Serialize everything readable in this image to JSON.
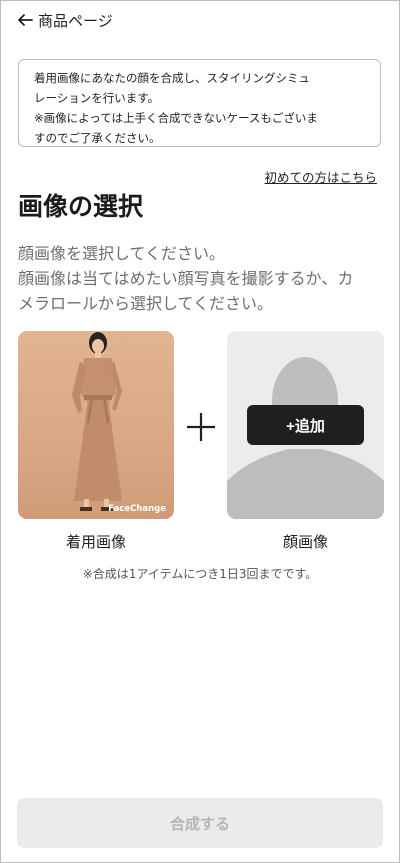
{
  "header": {
    "back_label": "商品ページ"
  },
  "notice": {
    "lines": [
      "着用画像にあなたの顔を合成し、スタイリングシミュ",
      "レーションを行います。",
      "※画像によっては上手く合成できないケースもございま",
      "すのでご了承ください。"
    ]
  },
  "first_time_link": "初めての方はこちら",
  "page_title": "画像の選択",
  "description": {
    "lines": [
      "顔画像を選択してください。",
      "顔画像は当てはめたい顔写真を撮影するか、カ",
      "メラロールから選択してください。"
    ]
  },
  "outfit_image": {
    "watermark": "FaceChange",
    "label": "着用画像"
  },
  "face_image": {
    "add_label": "+追加",
    "label": "顔画像"
  },
  "limit_note": "※合成は1アイテムにつき1日3回までです。",
  "submit_label": "合成する",
  "colors": {
    "accent": "#1f1f1f",
    "outfit_background": "#dcaa86",
    "placeholder_background": "#ececec",
    "disabled_button": "#ebebeb"
  },
  "icons": [
    "back-arrow-icon",
    "plus-icon",
    "person-silhouette-icon"
  ]
}
